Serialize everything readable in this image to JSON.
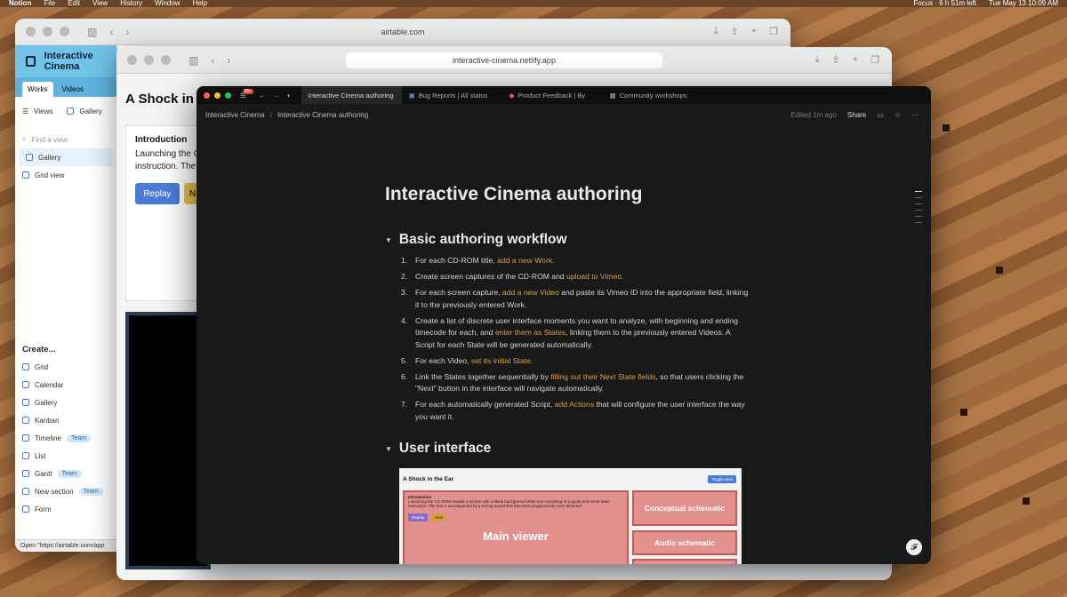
{
  "menubar": {
    "app": "Notion",
    "items": [
      "File",
      "Edit",
      "View",
      "History",
      "Window",
      "Help"
    ],
    "focus": "Focus · 6 h 51m left",
    "datetime": "Tue May 13  10:09 AM"
  },
  "airtable": {
    "url": "airtable.com",
    "base_title": "Interactive Cinema",
    "tabs": [
      "Works",
      "Videos"
    ],
    "views_label": "Views",
    "gallery_label": "Gallery",
    "find_placeholder": "Find a view",
    "views": [
      "Gallery",
      "Grid view"
    ],
    "create_label": "Create...",
    "create_items": [
      {
        "label": "Grid",
        "badge": ""
      },
      {
        "label": "Calendar",
        "badge": ""
      },
      {
        "label": "Gallery",
        "badge": ""
      },
      {
        "label": "Kanban",
        "badge": ""
      },
      {
        "label": "Timeline",
        "badge": "Team"
      },
      {
        "label": "List",
        "badge": ""
      },
      {
        "label": "Gantt",
        "badge": "Team"
      },
      {
        "label": "New section",
        "badge": "Team"
      },
      {
        "label": "Form",
        "badge": ""
      }
    ],
    "status_text": "Open \"https://airtable.com/app"
  },
  "netlify": {
    "url": "interactive-cinema.netlify.app",
    "title": "A Shock in t",
    "intro_heading": "Introduction",
    "intro_text": "Launching the C instruction. The",
    "replay_label": "Replay",
    "next_label": "N"
  },
  "notion": {
    "tabs": [
      "Interactive Cinema authoring",
      "Bug Reports | All status",
      "Product Feedback | By",
      "Community workshops"
    ],
    "badge": "99+",
    "breadcrumb": [
      "Interactive Cinema",
      "Interactive Cinema authoring"
    ],
    "edited": "Edited 1m ago",
    "share_label": "Share",
    "page_title": "Interactive Cinema authoring",
    "section1_title": "Basic authoring workflow",
    "section2_title": "User interface",
    "steps": [
      {
        "n": "1.",
        "parts": [
          {
            "t": "For each CD-ROM title, "
          },
          {
            "t": "add a new Work.",
            "link": true
          }
        ]
      },
      {
        "n": "2.",
        "parts": [
          {
            "t": "Create screen captures of the CD-ROM and "
          },
          {
            "t": "upload to Vimeo.",
            "link": true
          }
        ]
      },
      {
        "n": "3.",
        "parts": [
          {
            "t": "For each screen capture, "
          },
          {
            "t": "add a new Video",
            "link": true
          },
          {
            "t": " and paste its Vimeo ID into the appropriate field, linking it to the previously entered Work."
          }
        ]
      },
      {
        "n": "4.",
        "parts": [
          {
            "t": "Create a list of discrete user interface moments you want to analyze, with beginning and ending timecode for each, and "
          },
          {
            "t": "enter them as States",
            "link": true
          },
          {
            "t": ", linking them to the previously entered Videos. A Script for each State will be generated automatically."
          }
        ]
      },
      {
        "n": "5.",
        "parts": [
          {
            "t": "For each Video, "
          },
          {
            "t": "set its initial State",
            "link": true
          },
          {
            "t": "."
          }
        ]
      },
      {
        "n": "6.",
        "parts": [
          {
            "t": "Link the States together sequentially by "
          },
          {
            "t": "filling out their Next State fields",
            "link": true
          },
          {
            "t": ", so that users clicking the \"Next\" button in the interface will navigate automatically."
          }
        ]
      },
      {
        "n": "7.",
        "parts": [
          {
            "t": "For each automatically generated Script, "
          },
          {
            "t": "add Actions",
            "link": true
          },
          {
            "t": " that will configure the user interface the way you want it."
          }
        ]
      }
    ],
    "preview": {
      "title": "A Shock in the Ear",
      "toggle": "Toggle view",
      "intro_heading": "Introduction",
      "intro_text": "Launching the CD-ROM reveals a screen with a black background white text consisting of a quote and some basic instruction. The text is accompanied by a ticking sound that becomes progressively more distorted.",
      "replay": "Replay",
      "next": "Next",
      "main_label": "Main viewer",
      "conceptual_label": "Conceptual schematic",
      "audio_label": "Audio schematic"
    }
  }
}
